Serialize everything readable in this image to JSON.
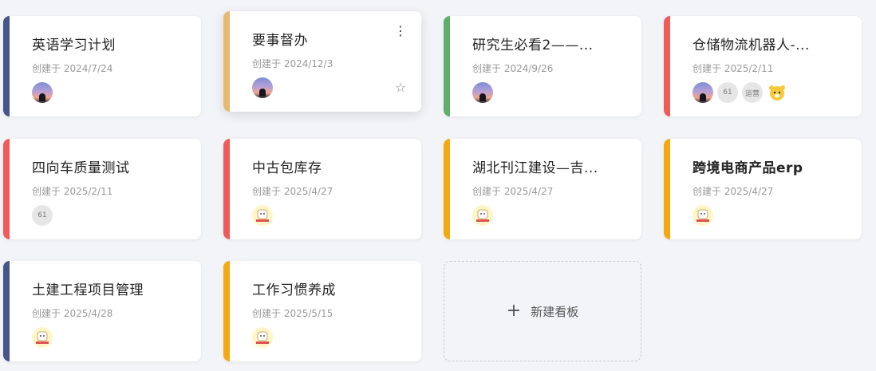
{
  "colors": {
    "blue": "#475589",
    "tan": "#e8b971",
    "green": "#5fae6e",
    "red": "#ee5b5b",
    "yellow": "#f4a912"
  },
  "boards": [
    {
      "title": "英语学习计划",
      "created": "创建于 2024/7/24",
      "color": "blue",
      "members": [
        "photo"
      ]
    },
    {
      "title": "要事督办",
      "created": "创建于 2024/12/3",
      "color": "tan",
      "members": [
        "photo"
      ],
      "menu_icon": "more-vertical-icon",
      "star_icon": "star-outline-icon"
    },
    {
      "title": "研究生必看2——...",
      "created": "创建于 2024/9/26",
      "color": "green",
      "members": [
        "photo"
      ]
    },
    {
      "title": "仓储物流机器人-...",
      "created": "创建于 2025/2/11",
      "color": "red",
      "members": [
        "photo",
        "61",
        "运营",
        "bear"
      ]
    },
    {
      "title": "四向车质量测试",
      "created": "创建于 2025/2/11",
      "color": "red",
      "members": [
        "61"
      ]
    },
    {
      "title": "中古包库存",
      "created": "创建于 2025/4/27",
      "color": "red",
      "members": [
        "badge"
      ]
    },
    {
      "title": "湖北刊江建设—吉...",
      "created": "创建于 2025/4/27",
      "color": "yellow",
      "members": [
        "badge"
      ]
    },
    {
      "title": "跨境电商产品erp",
      "created": "创建于 2025/4/27",
      "color": "yellow",
      "members": [
        "badge"
      ]
    },
    {
      "title": "土建工程项目管理",
      "created": "创建于 2025/4/28",
      "color": "blue",
      "members": [
        "badge"
      ]
    },
    {
      "title": "工作习惯养成",
      "created": "创建于 2025/5/15",
      "color": "yellow",
      "members": [
        "badge"
      ]
    }
  ],
  "member_labels": {
    "m61": "61",
    "yunying": "运营"
  },
  "new_board": {
    "label": "新建看板",
    "icon": "plus-icon"
  }
}
